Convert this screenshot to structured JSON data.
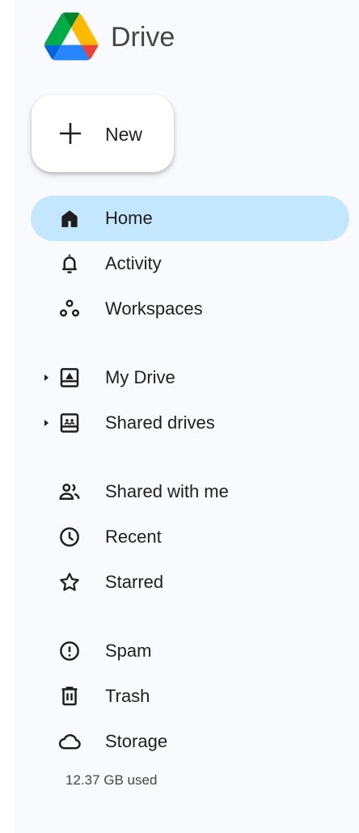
{
  "app": {
    "title": "Drive"
  },
  "new_button": {
    "label": "New"
  },
  "nav": {
    "home": "Home",
    "activity": "Activity",
    "workspaces": "Workspaces",
    "my_drive": "My Drive",
    "shared_drives": "Shared drives",
    "shared_with_me": "Shared with me",
    "recent": "Recent",
    "starred": "Starred",
    "spam": "Spam",
    "trash": "Trash",
    "storage": "Storage"
  },
  "storage": {
    "used": "12.37 GB used"
  },
  "colors": {
    "active_bg": "#c2e7ff",
    "sidebar_bg": "#f8fafd",
    "text": "#1f1f1f",
    "logo_blue": "#4285f4",
    "logo_green": "#0f9d58",
    "logo_yellow": "#f4b400",
    "logo_red": "#ea4335"
  }
}
